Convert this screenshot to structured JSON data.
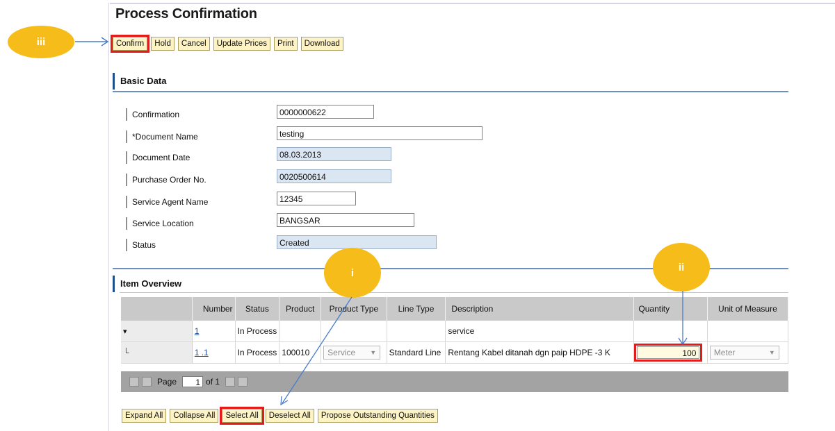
{
  "page": {
    "title": "Process Confirmation"
  },
  "annotations": {
    "iii": "iii",
    "i": "i",
    "ii": "ii"
  },
  "toolbar": {
    "buttons": [
      "Confirm",
      "Hold",
      "Cancel",
      "Update Prices",
      "Print",
      "Download"
    ]
  },
  "basic_data": {
    "title": "Basic Data",
    "fields": [
      {
        "label": "Confirmation",
        "value": "0000000622"
      },
      {
        "label": "*Document Name",
        "value": "testing"
      },
      {
        "label": "Document Date",
        "value": "08.03.2013"
      },
      {
        "label": "Purchase Order No.",
        "value": "0020500614"
      },
      {
        "label": "Service Agent Name",
        "value": "12345"
      },
      {
        "label": "Service Location",
        "value": "BANGSAR"
      },
      {
        "label": "Status",
        "value": "Created"
      }
    ]
  },
  "item_overview": {
    "title": "Item Overview",
    "columns": [
      "Number",
      "Status",
      "Product",
      "Product Type",
      "Line Type",
      "Description",
      "Quantity",
      "Unit of Measure"
    ],
    "rows": [
      {
        "marker": "▾",
        "number": "1",
        "status": "In Process",
        "product": "",
        "product_type": "",
        "line_type": "",
        "description": "service",
        "quantity": "",
        "uom": ""
      },
      {
        "marker": "└",
        "number": "1 .1",
        "status": "In Process",
        "product": "100010",
        "product_type": "Service",
        "line_type": "Standard Line",
        "description": "Rentang Kabel ditanah dgn paip HDPE -3 K",
        "quantity": "100",
        "uom": "Meter"
      }
    ],
    "pager": {
      "label": "Page",
      "current": "1",
      "of_label": "of 1"
    }
  },
  "bottom_buttons": [
    "Expand All",
    "Collapse All",
    "Select All",
    "Deselect All",
    "Propose Outstanding Quantities"
  ],
  "colors": {
    "highlight": "#e21b1b",
    "bubble": "#f5bc1a",
    "button_bg": "#fdf3c4",
    "section_accent": "#1e4d8f"
  }
}
